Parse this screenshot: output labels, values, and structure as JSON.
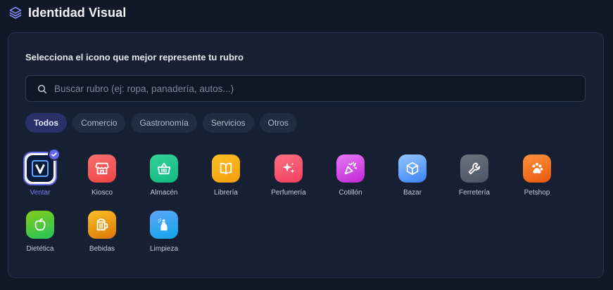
{
  "header": {
    "title": "Identidad Visual",
    "icon": "layers-icon"
  },
  "card": {
    "prompt": "Selecciona el icono que mejor represente tu rubro"
  },
  "search": {
    "placeholder": "Buscar rubro (ej: ropa, panadería, autos...)",
    "value": "",
    "icon": "search-icon"
  },
  "filters": [
    {
      "label": "Todos",
      "active": true
    },
    {
      "label": "Comercio",
      "active": false
    },
    {
      "label": "Gastronomía",
      "active": false
    },
    {
      "label": "Servicios",
      "active": false
    },
    {
      "label": "Otros",
      "active": false
    }
  ],
  "icons": [
    {
      "label": "Ventar",
      "icon": "ventar-logo-icon",
      "selected": true,
      "colors": [
        "#0c1a3a",
        "#0c1a3a"
      ]
    },
    {
      "label": "Kiosco",
      "icon": "storefront-icon",
      "selected": false,
      "colors": [
        "#f87171",
        "#ef4444"
      ]
    },
    {
      "label": "Almacén",
      "icon": "shopping-basket-icon",
      "selected": false,
      "colors": [
        "#34d399",
        "#10b981"
      ]
    },
    {
      "label": "Librería",
      "icon": "open-book-icon",
      "selected": false,
      "colors": [
        "#fbbf24",
        "#f59e0b"
      ]
    },
    {
      "label": "Perfumería",
      "icon": "sparkles-icon",
      "selected": false,
      "colors": [
        "#fb7185",
        "#f43f5e"
      ]
    },
    {
      "label": "Cotillón",
      "icon": "party-popper-icon",
      "selected": false,
      "colors": [
        "#e879f9",
        "#c026d3"
      ]
    },
    {
      "label": "Bazar",
      "icon": "package-box-icon",
      "selected": false,
      "colors": [
        "#93c5fd",
        "#3b82f6"
      ]
    },
    {
      "label": "Ferretería",
      "icon": "wrench-icon",
      "selected": false,
      "colors": [
        "#6b7280",
        "#4b5563"
      ]
    },
    {
      "label": "Petshop",
      "icon": "paw-print-icon",
      "selected": false,
      "colors": [
        "#fb923c",
        "#ea580c"
      ]
    },
    {
      "label": "Dietética",
      "icon": "apple-icon",
      "selected": false,
      "colors": [
        "#84cc16",
        "#22c55e"
      ]
    },
    {
      "label": "Bebidas",
      "icon": "beer-mug-icon",
      "selected": false,
      "colors": [
        "#fbbf24",
        "#d97706"
      ]
    },
    {
      "label": "Limpieza",
      "icon": "spray-bottle-icon",
      "selected": false,
      "colors": [
        "#60a5fa",
        "#0ea5e9"
      ]
    }
  ],
  "colors": {
    "accent": "#6366f1",
    "background": "#111827",
    "card": "#172033"
  }
}
